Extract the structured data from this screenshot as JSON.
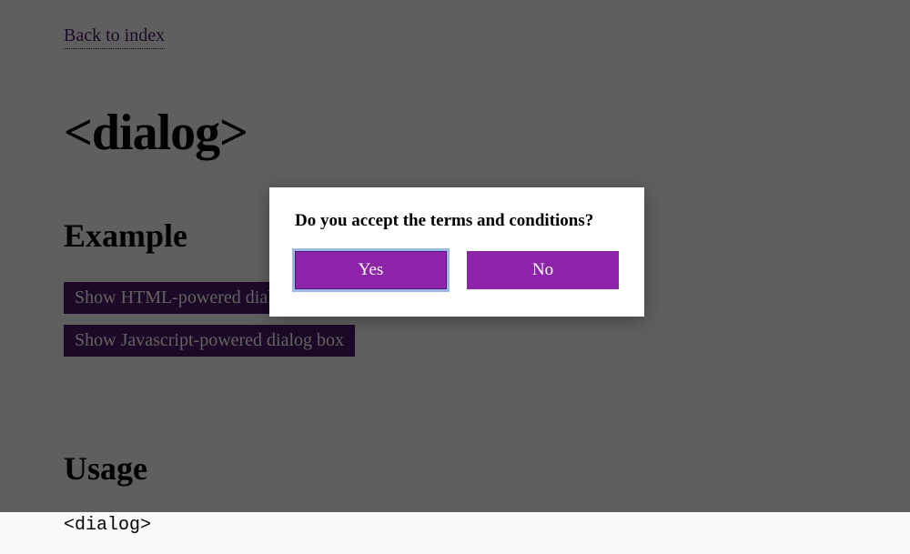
{
  "nav": {
    "back_link": "Back to index"
  },
  "title": "<dialog>",
  "sections": {
    "example": {
      "heading": "Example",
      "buttons": [
        "Show HTML-powered dialog box",
        "Show Javascript-powered dialog box"
      ]
    },
    "usage": {
      "heading": "Usage",
      "code": "<dialog>"
    }
  },
  "dialog": {
    "message": "Do you accept the terms and conditions?",
    "yes": "Yes",
    "no": "No"
  },
  "colors": {
    "accent": "#8e24aa",
    "accent_dark": "#4a1a6b",
    "focus_ring": "#9db8e8"
  }
}
